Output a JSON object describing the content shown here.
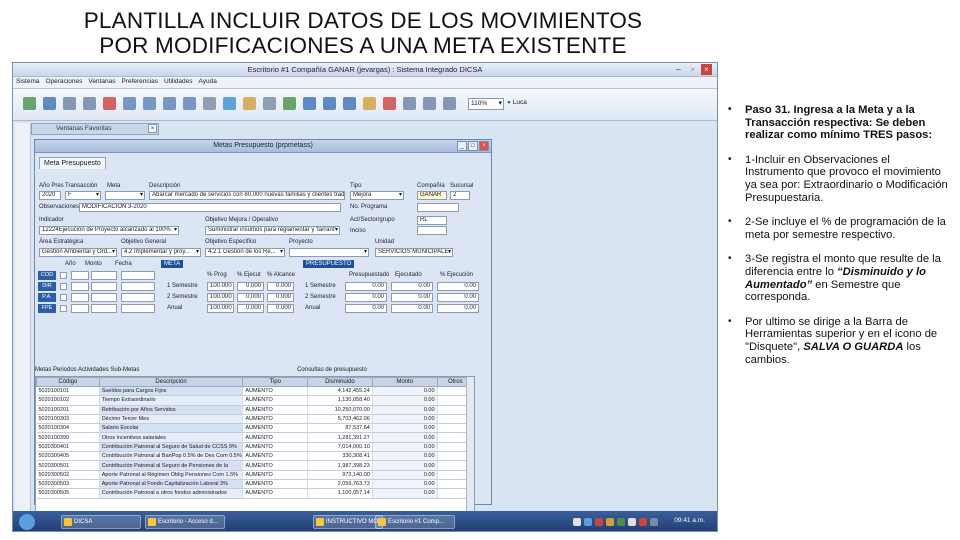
{
  "slide": {
    "title_line1": "PLANTILLA INCLUIR DATOS DE LOS MOVIMIENTOS",
    "title_line2": "POR MODIFICACIONES A UNA META EXISTENTE"
  },
  "app": {
    "window_title": "Escritorio #1 Compañía GANAR (jevargas) : Sistema Integrado DICSA",
    "menu": [
      "Sistema",
      "Operaciones",
      "Ventanas",
      "Preferencias",
      "Utilidades",
      "Ayuda"
    ],
    "zoom": "110%",
    "user": "Luca",
    "favorites_window": "Ventanas Favoritas",
    "inner_window_title": "Metas Presupuesto (prpmetass)",
    "tab_label": "Meta Presupuesto",
    "fields": {
      "ano_label": "Año Pres",
      "ano_value": "2020",
      "transaccion_label": "Transacción",
      "transaccion_value": "F",
      "meta_label": "Meta",
      "descripcion_label": "Descripción",
      "descripcion_value": "Abarcar mercado de servicios con 80,000 nuevas familias y clientes tradicionales",
      "tipo_label": "Tipo",
      "tipo_value": "Mejora",
      "compania_label": "Compañía",
      "compania_value": "GANAR",
      "sucursal_label": "Sucursal",
      "sucursal_value": "2",
      "observaciones_label": "Observaciones",
      "observaciones_value": "MODIFICACION 3-2020",
      "no_programa_label": "No. Programa",
      "indicador_label": "Indicador",
      "indicador_value": "12224Ejecución de Proyecto alcanzado al 100%",
      "objetivo_mejora_label": "Objetivo Mejora / Operativo",
      "objetivo_mejora_value": "Suministrar insumos para reglamentar y 'tarrant'",
      "actividad_label": "Act/Sector/grupo",
      "actividad_value": "RL",
      "inciso_label": "Inciso",
      "inciso_value": "7",
      "area_label": "Área Estratégica",
      "area_value": "Gestión Ambiental y Ord...",
      "objgeneral_label": "Objetivo General",
      "objgeneral_value": "4.2 Implementar y proy...",
      "objespecifico_label": "Objetivo Específico",
      "objespecifico_value": "4.2.1 Gestión de los Re...",
      "proyecto_label": "Proyecto",
      "unidad_label": "Unidad",
      "unidad_value": "SERVICIOS MUNICIPALE..."
    },
    "side_buttons": [
      "COD",
      "DIR",
      "P.A.",
      "FPE"
    ],
    "columns_left": [
      "Año",
      "Monto",
      "Fecha"
    ],
    "meta_box": "META",
    "pct_headers": [
      "% Prog",
      "% Ejecut",
      "% Alcance"
    ],
    "semesters": [
      "1 Semestre",
      "2 Semestre",
      "Anual"
    ],
    "sem_values": [
      [
        "100.000",
        "0.000",
        "0.000"
      ],
      [
        "100.000",
        "0.000",
        "0.000"
      ],
      [
        "100.000",
        "0.000",
        "0.000"
      ]
    ],
    "presupuesto_box": "PRESUPUESTO",
    "pres_headers": [
      "Presupuestado",
      "Ejecutado",
      "% Ejecución"
    ],
    "pres_values": [
      [
        "0.00",
        "0.00",
        "0.00"
      ],
      [
        "0.00",
        "0.00",
        "0.00"
      ],
      [
        "0.00",
        "0.00",
        "0.00"
      ]
    ],
    "grid_tabs": "Metas Periodos  Actividades  Sub-Metas",
    "grid_right_label": "Consultas de presupuesto",
    "grid_headers": [
      "Código",
      "Descripción",
      "Tipo",
      "Disminuido",
      "Monto",
      "Otros"
    ],
    "grid_rows": [
      [
        "5020100101",
        "Sueldos para Cargos Fijos",
        "AUMENTO",
        "4,142,455.24",
        "0.00"
      ],
      [
        "5020100102",
        "Tiempo Extraordinario",
        "AUMENTO",
        "1,130,058.40",
        "0.00"
      ],
      [
        "5020100201",
        "Retribución por Años Servidos",
        "AUMENTO",
        "10,250,070.00",
        "0.00"
      ],
      [
        "5020100303",
        "Décimo Tercer Mes",
        "AUMENTO",
        "5,703,462.06",
        "0.00"
      ],
      [
        "5020100304",
        "Salario Escolar",
        "AUMENTO",
        "87,537.64",
        "0.00"
      ],
      [
        "5020100399",
        "Otros incentivos salariales",
        "AUMENTO",
        "1,281,391.27",
        "0.00"
      ],
      [
        "5020300401",
        "Contribución Patronal al Seguro de Salud de CCSS 9%",
        "AUMENTO",
        "7,014,000.10",
        "0.00"
      ],
      [
        "5020300405",
        "Contribución Patronal al BanPop 0.5% de Des Com 0.5%",
        "AUMENTO",
        "330,308.41",
        "0.00"
      ],
      [
        "5020300501",
        "Contribución Patronal al Seguro de Pensiones de la",
        "AUMENTO",
        "1,987,398.23",
        "0.00"
      ],
      [
        "5020300502",
        "Aporte Patronal al Régimen Oblig Pensiones Com 1.5%",
        "AUMENTO",
        "973,140.00",
        "0.00"
      ],
      [
        "5020300503",
        "Aporte Patronal al Fondo Capitalización Laboral 3%",
        "AUMENTO",
        "2,059,763.73",
        "0.00"
      ],
      [
        "5020300505",
        "Contribución Patronal a otros fondos administrados",
        "AUMENTO",
        "1,100,057.14",
        "0.00"
      ]
    ],
    "taskbar": [
      "DICSA",
      "Escritorio - Acceso d...",
      "INSTRUCTIVO MO...",
      "Escritorio #1 Comp..."
    ],
    "clock": "09:41 a.m."
  },
  "bullets": {
    "b1": "Paso 31. Ingresa a la Meta y a la Transacción respectiva: Se deben realizar como mínimo TRES pasos:",
    "b2": "1-Incluir en Observaciones el Instrumento que provoco el movimiento ya sea por: Extraordinario o Modificación Presupuestaria.",
    "b3": "2-Se incluye el % de programación de la meta por semestre respectivo.",
    "b4_a": "3-Se registra el monto que resulte de la diferencia entre lo ",
    "b4_b": "“Disminuido y lo Aumentado”",
    "b4_c": " en Semestre que corresponda.",
    "b5_a": "Por ultimo se dirige a la Barra de Herramientas superior y en el icono de \"Disquete\", ",
    "b5_b": "SALVA O GUARDA",
    "b5_c": " los cambios."
  },
  "colors": {
    "accent": "#1f4e9a",
    "grid_highlight": "#d5e0f3",
    "taskbar": "#1f3d70"
  }
}
